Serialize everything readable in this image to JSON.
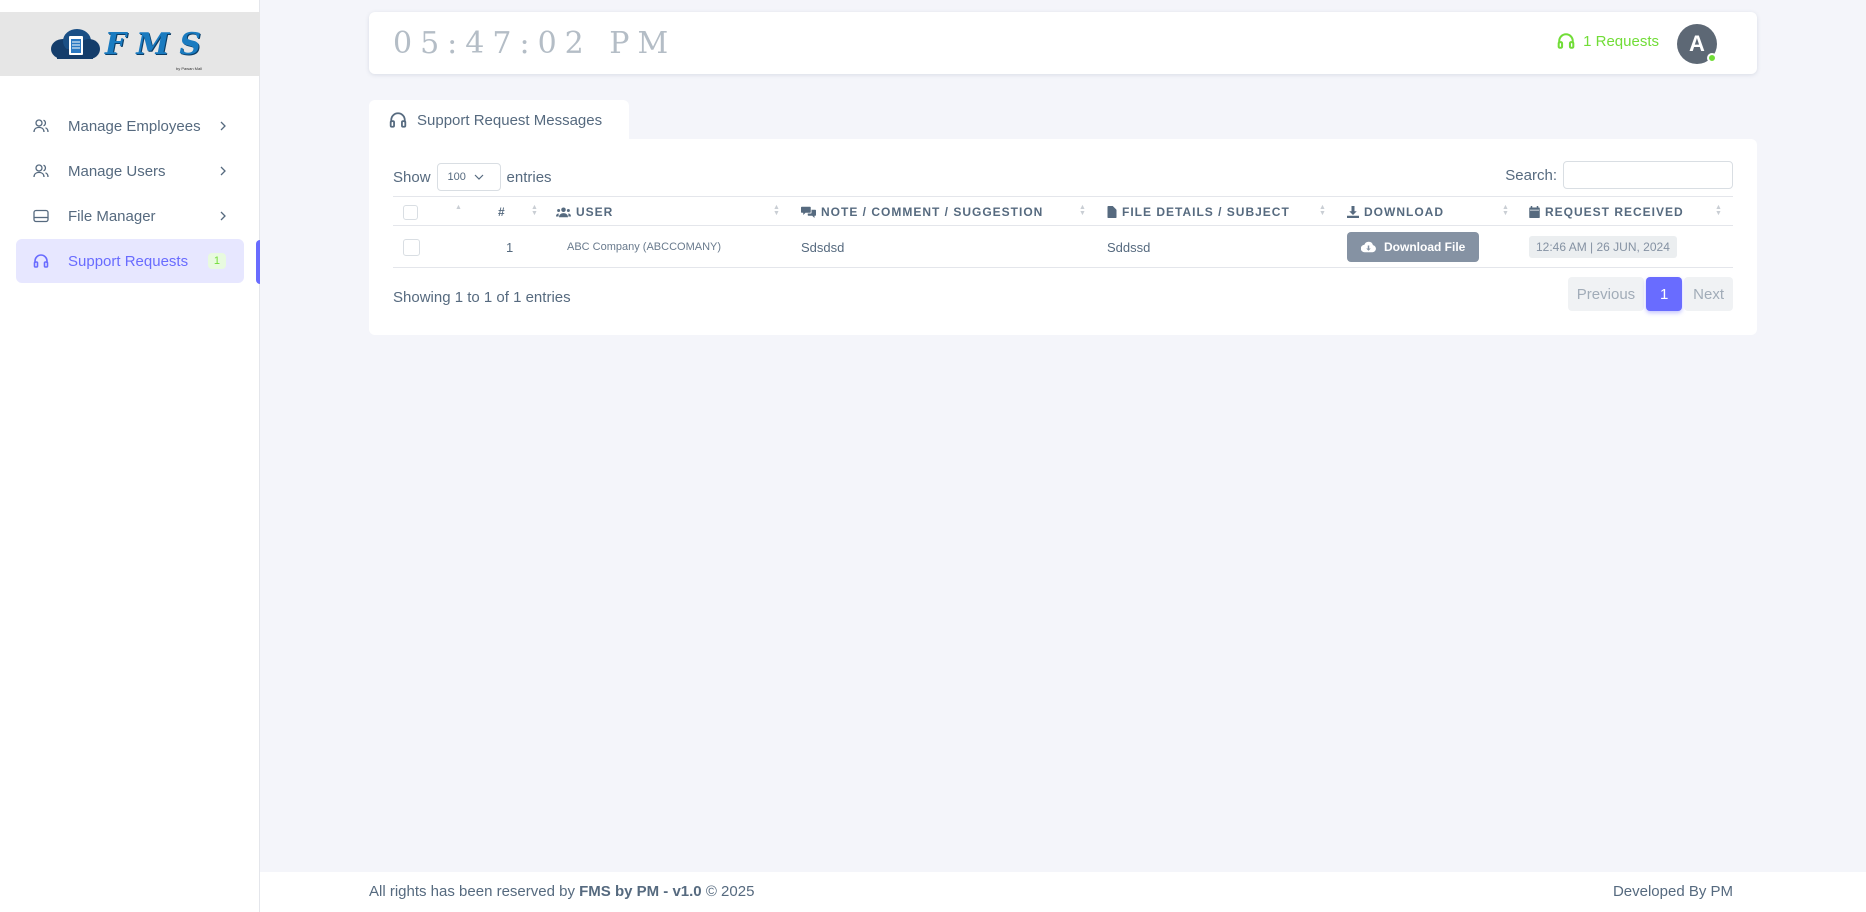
{
  "logo": {
    "letters": "FMS",
    "tagline": "by Pawan Mall"
  },
  "sidebar": {
    "items": [
      {
        "label": "Manage Employees",
        "icon": "users-icon"
      },
      {
        "label": "Manage Users",
        "icon": "users-icon"
      },
      {
        "label": "File Manager",
        "icon": "drive-icon"
      },
      {
        "label": "Support Requests",
        "icon": "headset-icon",
        "badge": "1",
        "active": true
      }
    ]
  },
  "navbar": {
    "clock": "05:47:02 PM",
    "requests_label": "1 Requests",
    "avatar_initial": "A"
  },
  "tab": {
    "label": "Support Request Messages"
  },
  "table": {
    "show_label": "Show",
    "entries_value": "100",
    "entries_label": "entries",
    "search_label": "Search:",
    "columns": {
      "num": "#",
      "user": "User",
      "note": "Note / Comment / Suggestion",
      "file": "File Details / Subject",
      "download": "Download",
      "received": "Request Received"
    },
    "rows": [
      {
        "num": "1",
        "user": "ABC Company (ABCCOMANY)",
        "note": "Sdsdsd",
        "file": "Sddssd",
        "download_label": "Download File",
        "received": "12:46 AM | 26 JUN, 2024"
      }
    ],
    "info": "Showing 1 to 1 of 1 entries",
    "pagination": {
      "previous": "Previous",
      "current": "1",
      "next": "Next"
    }
  },
  "footer": {
    "prefix": "All rights has been reserved by",
    "brand": "FMS by PM - v1.0",
    "suffix": "© 2025",
    "developer": "Developed By PM"
  },
  "colors": {
    "primary": "#696cff",
    "success": "#71dd37",
    "secondary": "#8592a3",
    "text": "#566a7f"
  }
}
